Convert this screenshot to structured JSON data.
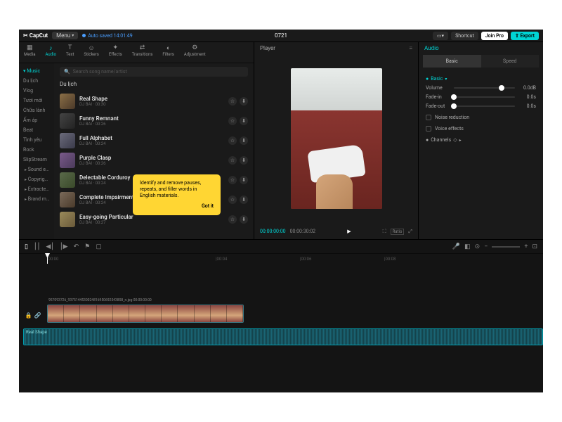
{
  "topbar": {
    "logo": "✂ CapCut",
    "menu": "Menu",
    "autosave": "Auto saved 14:01:49",
    "title": "0721",
    "shortcut": "Shortcut",
    "joinpro": "Join Pro",
    "export": "⇧ Export"
  },
  "tabs": [
    {
      "icon": "▦",
      "label": "Media"
    },
    {
      "icon": "♪",
      "label": "Audio"
    },
    {
      "icon": "T",
      "label": "Text"
    },
    {
      "icon": "☺",
      "label": "Stickers"
    },
    {
      "icon": "✦",
      "label": "Effects"
    },
    {
      "icon": "⇄",
      "label": "Transitions"
    },
    {
      "icon": "◐",
      "label": "Filters"
    },
    {
      "icon": "⚙",
      "label": "Adjustment"
    }
  ],
  "sidebar": [
    "Music",
    "Du lịch",
    "Vlog",
    "Tươi mới",
    "Chữa lành",
    "Ấm áp",
    "Beat",
    "Tình yêu",
    "Rock",
    "SlipStream",
    "Sound effe...",
    "Copyright i...",
    "Extracted a...",
    "Brand musi..."
  ],
  "search": {
    "placeholder": "Search song name/artist"
  },
  "category": "Du lịch",
  "tracks": [
    {
      "name": "Real Shape",
      "meta": "DJ BAI · 00:30"
    },
    {
      "name": "Funny Remnant",
      "meta": "DJ BAI · 00:26"
    },
    {
      "name": "Full Alphabet",
      "meta": "DJ BAI · 00:24"
    },
    {
      "name": "Purple Clasp",
      "meta": "DJ BAI · 00:26"
    },
    {
      "name": "Delectable Corduroy",
      "meta": "DJ BAI · 00:24"
    },
    {
      "name": "Complete Impairment",
      "meta": "DJ BAI · 00:24"
    },
    {
      "name": "Easy-going Particular",
      "meta": "DJ BAI · 00:27"
    }
  ],
  "tooltip": {
    "text": "Identify and remove pauses, repeats, and filler words in English materials.",
    "btn": "Got it"
  },
  "preview": {
    "title": "Player",
    "time_current": "00:00:00:00",
    "time_total": "00:00:30:02"
  },
  "audio": {
    "title": "Audio",
    "tabs": [
      "Basic",
      "Speed"
    ],
    "section_basic": "Basic",
    "volume": {
      "label": "Volume",
      "value": "0.0dB",
      "pos": 78
    },
    "fadein": {
      "label": "Fade-in",
      "value": "0.0s",
      "pos": 0
    },
    "fadeout": {
      "label": "Fade-out",
      "value": "0.0s",
      "pos": 0
    },
    "noise": "Noise reduction",
    "voice": "Voice effects",
    "channels": "Channels"
  },
  "ruler": [
    "|00:00",
    "|00:04",
    "|00:06",
    "|00:08"
  ],
  "clip_video_name": "957093726_9375144530024816950692543858_n.jpg 00:00:00:00",
  "clip_audio_name": "Real Shape"
}
